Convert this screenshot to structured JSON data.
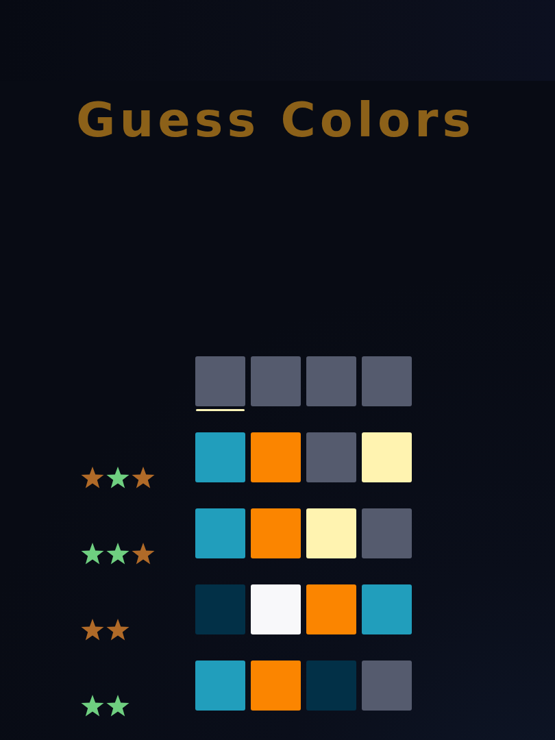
{
  "title": "Guess Colors",
  "current_row": {
    "tiles": [
      {
        "color": "#555b6e",
        "selected": true
      },
      {
        "color": "#555b6e",
        "selected": false
      },
      {
        "color": "#555b6e",
        "selected": false
      },
      {
        "color": "#555b6e",
        "selected": false
      }
    ]
  },
  "guesses": [
    {
      "feedback": [
        {
          "color": "#b06a28"
        },
        {
          "color": "#6fcf80"
        },
        {
          "color": "#b06a28"
        }
      ],
      "tiles": [
        {
          "color": "#219ebc"
        },
        {
          "color": "#fb8500"
        },
        {
          "color": "#555b6e"
        },
        {
          "color": "#fff3b0"
        }
      ]
    },
    {
      "feedback": [
        {
          "color": "#6fcf80"
        },
        {
          "color": "#6fcf80"
        },
        {
          "color": "#b06a28"
        }
      ],
      "tiles": [
        {
          "color": "#219ebc"
        },
        {
          "color": "#fb8500"
        },
        {
          "color": "#fff3b0"
        },
        {
          "color": "#555b6e"
        }
      ]
    },
    {
      "feedback": [
        {
          "color": "#b06a28"
        },
        {
          "color": "#b06a28"
        }
      ],
      "tiles": [
        {
          "color": "#023047"
        },
        {
          "color": "#f8f8fa"
        },
        {
          "color": "#fb8500"
        },
        {
          "color": "#219ebc"
        }
      ]
    },
    {
      "feedback": [
        {
          "color": "#6fcf80"
        },
        {
          "color": "#6fcf80"
        }
      ],
      "tiles": [
        {
          "color": "#219ebc"
        },
        {
          "color": "#fb8500"
        },
        {
          "color": "#023047"
        },
        {
          "color": "#555b6e"
        }
      ]
    }
  ]
}
